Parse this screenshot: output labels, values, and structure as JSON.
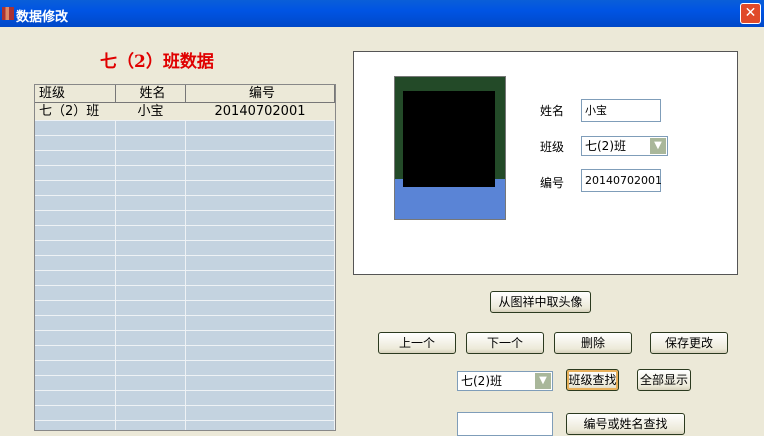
{
  "window": {
    "title": "数据修改",
    "close": "✕"
  },
  "heading": "七（2）班数据",
  "table": {
    "headers": [
      "班级",
      "姓名",
      "编号"
    ],
    "rows": [
      [
        "七（2）班",
        "小宝",
        "20140702001"
      ]
    ]
  },
  "detail": {
    "name_label": "姓名",
    "name_value": "小宝",
    "class_label": "班级",
    "class_value": "七(2)班",
    "id_label": "编号",
    "id_value": "20140702001"
  },
  "buttons": {
    "photo": "从图祥中取头像",
    "prev": "上一个",
    "next": "下一个",
    "delete": "删除",
    "save": "保存更改",
    "class_search": "班级查找",
    "show_all": "全部显示",
    "id_name_search": "编号或姓名查找"
  },
  "search": {
    "class_select": "七(2)班",
    "keyword": ""
  }
}
